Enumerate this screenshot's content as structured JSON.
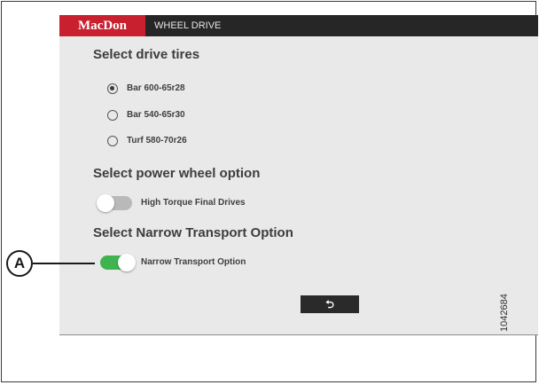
{
  "header": {
    "logo_text": "MacDon",
    "title": "WHEEL DRIVE",
    "brand_color": "#c8202f"
  },
  "tires": {
    "heading": "Select drive tires",
    "options": [
      {
        "label": "Bar 600-65r28",
        "checked": true
      },
      {
        "label": "Bar 540-65r30",
        "checked": false
      },
      {
        "label": "Turf 580-70r26",
        "checked": false
      }
    ]
  },
  "power_wheel": {
    "heading": "Select power wheel option",
    "toggle_label": "High Torque Final Drives",
    "enabled": false
  },
  "narrow_transport": {
    "heading": "Select Narrow Transport Option",
    "toggle_label": "Narrow Transport Option",
    "enabled": true,
    "toggle_color": "#3fb34f"
  },
  "back_button": {
    "icon": "back-arrow-icon",
    "glyph": "⮌"
  },
  "callout": {
    "letter": "A"
  },
  "figure_number": "1042684"
}
